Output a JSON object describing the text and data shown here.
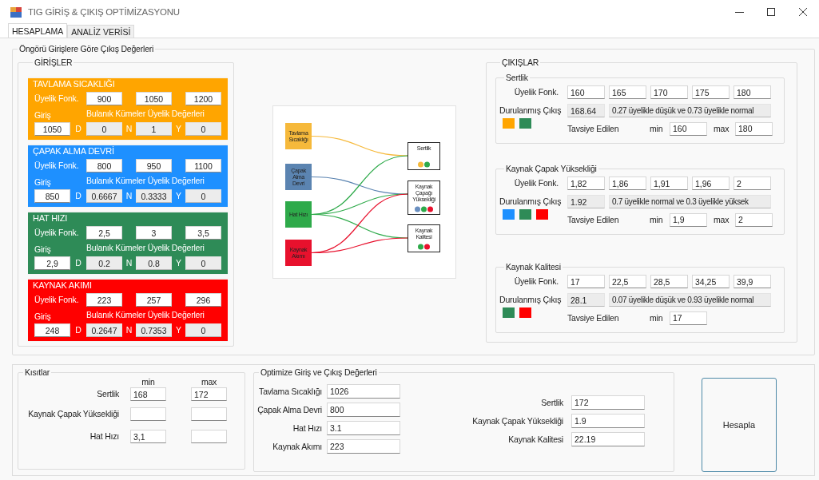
{
  "window": {
    "title": "TIG GİRİŞ & ÇIKIŞ OPTİMİZASYONU"
  },
  "tabs": [
    {
      "label": "HESAPLAMA",
      "selected": true
    },
    {
      "label": "ANALİZ VERİSİ",
      "selected": false
    }
  ],
  "prediction_group": {
    "title": "Öngörü Girişlere Göre Çıkış Değerleri",
    "inputs": {
      "title": "GİRİŞLER",
      "panels": [
        {
          "title": "TAVLAMA SICAKLIĞI",
          "color": "#ffa500",
          "membership_label": "Üyelik Fonk.",
          "membership": [
            "900",
            "1050",
            "1200"
          ],
          "input_label": "Giriş",
          "fuzzy_label": "Bulanık Kümeler Üyelik Değerleri",
          "input": "1050",
          "fuzzy": [
            {
              "letter": "D",
              "value": "0"
            },
            {
              "letter": "N",
              "value": "1"
            },
            {
              "letter": "Y",
              "value": "0"
            }
          ]
        },
        {
          "title": "ÇAPAK ALMA DEVRİ",
          "color": "#1e90ff",
          "membership_label": "Üyelik Fonk.",
          "membership": [
            "800",
            "950",
            "1100"
          ],
          "input_label": "Giriş",
          "fuzzy_label": "Bulanık Kümeler Üyelik Değerleri",
          "input": "850",
          "fuzzy": [
            {
              "letter": "D",
              "value": "0.6667"
            },
            {
              "letter": "N",
              "value": "0.3333"
            },
            {
              "letter": "Y",
              "value": "0"
            }
          ]
        },
        {
          "title": "HAT HIZI",
          "color": "#2e8b57",
          "membership_label": "Üyelik Fonk.",
          "membership": [
            "2,5",
            "3",
            "3,5"
          ],
          "input_label": "Giriş",
          "fuzzy_label": "Bulanık Kümeler Üyelik Değerleri",
          "input": "2,9",
          "fuzzy": [
            {
              "letter": "D",
              "value": "0.2"
            },
            {
              "letter": "N",
              "value": "0.8"
            },
            {
              "letter": "Y",
              "value": "0"
            }
          ]
        },
        {
          "title": "KAYNAK AKIMI",
          "color": "#ff0000",
          "membership_label": "Üyelik Fonk.",
          "membership": [
            "223",
            "257",
            "296"
          ],
          "input_label": "Giriş",
          "fuzzy_label": "Bulanık Kümeler Üyelik Değerleri",
          "input": "248",
          "fuzzy": [
            {
              "letter": "D",
              "value": "0.2647"
            },
            {
              "letter": "N",
              "value": "0.7353"
            },
            {
              "letter": "Y",
              "value": "0"
            }
          ]
        }
      ]
    },
    "diagram": {
      "sources": [
        {
          "label": [
            "Tavlama",
            "Sıcaklığı"
          ],
          "color": "#f6b93b"
        },
        {
          "label": [
            "Çapak",
            "Alma",
            "Devri"
          ],
          "color": "#5b84b1"
        },
        {
          "label": [
            "Hat Hızı"
          ],
          "color": "#2eaa4a"
        },
        {
          "label": [
            "Kaynak",
            "Akımı"
          ],
          "color": "#e8112d"
        }
      ],
      "targets": [
        {
          "label": [
            "Sertlik"
          ],
          "dots": [
            {
              "color": "#f6b93b"
            },
            {
              "color": "#2eaa4a"
            }
          ]
        },
        {
          "label": [
            "Kaynak",
            "Çapağı",
            "Yüksekliği"
          ],
          "dots": [
            {
              "color": "#6a8fc0"
            },
            {
              "color": "#2eaa4a"
            },
            {
              "color": "#e8112d"
            }
          ]
        },
        {
          "label": [
            "Kaynak",
            "Kalitesi"
          ],
          "dots": [
            {
              "color": "#2eaa4a"
            },
            {
              "color": "#e8112d"
            }
          ]
        }
      ]
    },
    "outputs": {
      "title": "ÇIKIŞLAR",
      "sections": [
        {
          "title": "Sertlik",
          "membership_label": "Üyelik Fonk.",
          "membership": [
            "160",
            "165",
            "170",
            "175",
            "180"
          ],
          "defuzz_label": "Durulanmış Çıkış",
          "defuzz": "168.64",
          "description": "0.27 üyelikle düşük ve 0.73 üyelikle normal",
          "swatches": [
            {
              "color": "#ffa500"
            },
            {
              "color": "#2e8b57"
            }
          ],
          "recommend_label": "Tavsiye Edilen",
          "min_label": "min",
          "min": "160",
          "max_label": "max",
          "max": "180"
        },
        {
          "title": "Kaynak Çapak Yüksekliği",
          "membership_label": "Üyelik Fonk.",
          "membership": [
            "1,82",
            "1,86",
            "1,91",
            "1,96",
            "2"
          ],
          "defuzz_label": "Durulanmış Çıkış",
          "defuzz": "1.92",
          "description": "0.7 üyelikle normal ve 0.3 üyelikle yüksek",
          "swatches": [
            {
              "color": "#1e90ff"
            },
            {
              "color": "#2e8b57"
            },
            {
              "color": "#ff0000"
            }
          ],
          "recommend_label": "Tavsiye Edilen",
          "min_label": "min",
          "min": "1,9",
          "max_label": "max",
          "max": "2"
        },
        {
          "title": "Kaynak Kalitesi",
          "membership_label": "Üyelik Fonk.",
          "membership": [
            "17",
            "22,5",
            "28,5",
            "34,25",
            "39,9"
          ],
          "defuzz_label": "Durulanmış Çıkış",
          "defuzz": "28.1",
          "description": "0.07 üyelikle düşük ve 0.93 üyelikle normal",
          "swatches": [
            {
              "color": "#2e8b57"
            },
            {
              "color": "#ff0000"
            }
          ],
          "recommend_label": "Tavsiye Edilen",
          "min_label": "min",
          "min": "17"
        }
      ]
    }
  },
  "constraints": {
    "title": "Kısıtlar",
    "min_header": "min",
    "max_header": "max",
    "rows": [
      {
        "label": "Sertlik",
        "min": "168",
        "max": "172"
      },
      {
        "label": "Kaynak Çapak Yüksekliği"
      },
      {
        "label": "Hat Hızı",
        "min": "3,1"
      }
    ]
  },
  "optimized": {
    "title": "Optimize Giriş ve Çıkış Değerleri",
    "inputs": [
      {
        "label": "Tavlama Sıcaklığı",
        "value": "1026"
      },
      {
        "label": "Çapak Alma Devri",
        "value": "800"
      },
      {
        "label": "Hat Hızı",
        "value": "3.1"
      },
      {
        "label": "Kaynak Akımı",
        "value": "223"
      }
    ],
    "outputs": [
      {
        "label": "Sertlik",
        "value": "172"
      },
      {
        "label": "Kaynak Çapak Yüksekliği",
        "value": "1.9"
      },
      {
        "label": "Kaynak Kalitesi",
        "value": "22.19"
      }
    ]
  },
  "calculate_button": "Hesapla"
}
